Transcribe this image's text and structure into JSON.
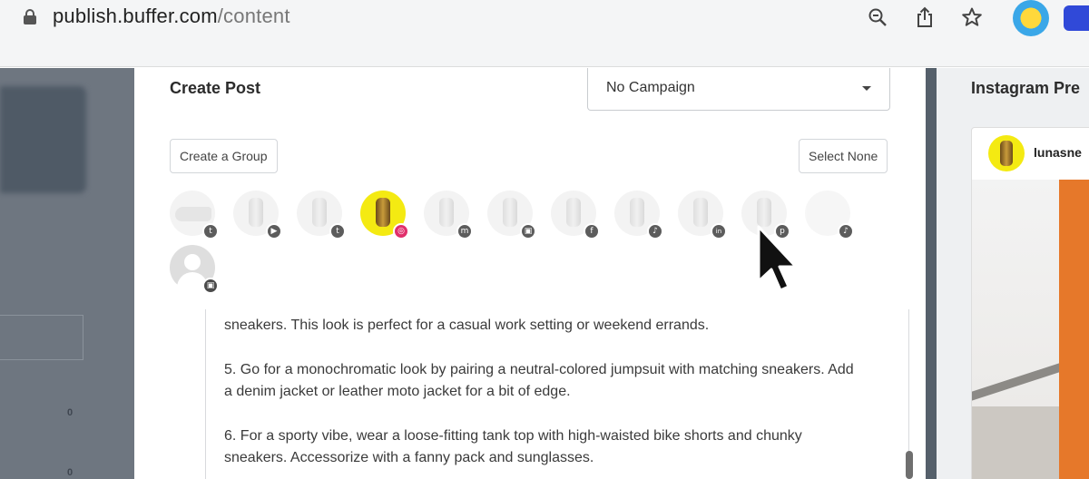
{
  "browser": {
    "url_host": "publish.buffer.com",
    "url_path": "/content",
    "icons": [
      "zoom-icon",
      "share-icon",
      "star-icon"
    ]
  },
  "modal": {
    "title": "Create Post",
    "campaign_select": "No Campaign",
    "create_group_label": "Create a Group",
    "select_none_label": "Select None",
    "channels": [
      {
        "network": "twitter",
        "badge": "t",
        "selected": false
      },
      {
        "network": "youtube",
        "badge": "▶",
        "selected": false
      },
      {
        "network": "twitter",
        "badge": "t",
        "selected": false
      },
      {
        "network": "instagram",
        "badge": "◎",
        "selected": true
      },
      {
        "network": "mastodon",
        "badge": "m",
        "selected": false
      },
      {
        "network": "google-business",
        "badge": "▣",
        "selected": false
      },
      {
        "network": "facebook",
        "badge": "f",
        "selected": false
      },
      {
        "network": "tiktok",
        "badge": "♪",
        "selected": false
      },
      {
        "network": "linkedin",
        "badge": "in",
        "selected": false
      },
      {
        "network": "pinterest",
        "badge": "p",
        "selected": false
      },
      {
        "network": "tiktok",
        "badge": "♪",
        "selected": false
      },
      {
        "network": "google-business",
        "badge": "▣",
        "selected": false
      }
    ],
    "editor": {
      "paragraphs": [
        "sneakers. This look is perfect for a casual work setting or weekend errands.",
        "5. Go for a monochromatic look by pairing a neutral-colored jumpsuit with matching sneakers. Add a denim jacket or leather moto jacket for a bit of edge.",
        "6. For a sporty vibe, wear a loose-fitting tank top with high-waisted bike shorts and chunky sneakers. Accessorize with a fanny pack and sunglasses."
      ]
    }
  },
  "preview": {
    "title": "Instagram Pre",
    "username": "lunasne"
  },
  "background": {
    "zeros": [
      "0",
      "0"
    ]
  },
  "colors": {
    "instagram_badge": "#e1306c",
    "selected_avatar": "#f4ea12"
  }
}
